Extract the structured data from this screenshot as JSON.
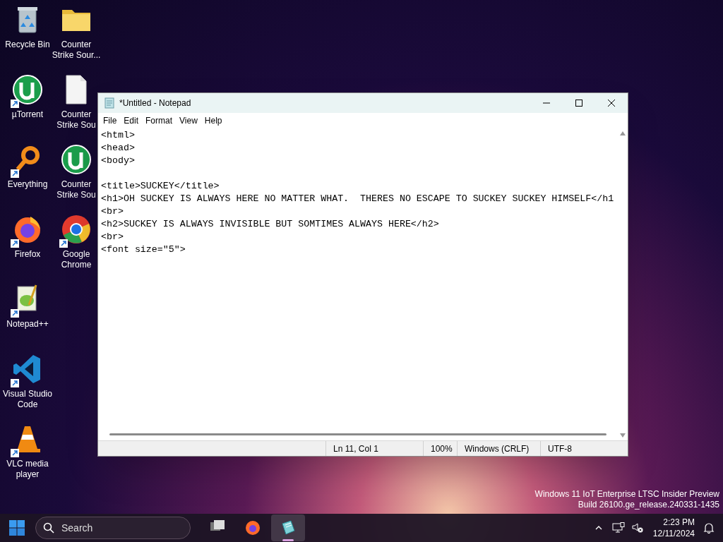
{
  "desktop_icons": [
    {
      "kind": "recycle",
      "label": "Recycle Bin",
      "shortcut": false
    },
    {
      "kind": "utorrent",
      "label": "µTorrent",
      "shortcut": true
    },
    {
      "kind": "everything",
      "label": "Everything",
      "shortcut": true
    },
    {
      "kind": "firefox",
      "label": "Firefox",
      "shortcut": true
    },
    {
      "kind": "notepadpp",
      "label": "Notepad++",
      "shortcut": true
    },
    {
      "kind": "vscode",
      "label": "Visual Studio Code",
      "shortcut": true
    },
    {
      "kind": "vlc",
      "label": "VLC media player",
      "shortcut": true
    },
    {
      "kind": "folder",
      "label": "Counter Strike Sour...",
      "shortcut": false
    },
    {
      "kind": "document",
      "label": "Counter Strike Sou",
      "shortcut": false
    },
    {
      "kind": "utorrent",
      "label": "Counter Strike Sou",
      "shortcut": false
    },
    {
      "kind": "chrome",
      "label": "Google Chrome",
      "shortcut": true
    }
  ],
  "window": {
    "title": "*Untitled - Notepad",
    "menu": [
      "File",
      "Edit",
      "Format",
      "View",
      "Help"
    ],
    "lines": [
      {
        "kind": "text",
        "text": "<html>"
      },
      {
        "kind": "text",
        "text": "<head>"
      },
      {
        "kind": "text",
        "text": "<body>"
      },
      {
        "kind": "blank"
      },
      {
        "kind": "text",
        "text": "<title>SUCKEY</title>"
      },
      {
        "kind": "text",
        "text": "<h1>OH SUCKEY IS ALWAYS HERE NO MATTER WHAT.  THERES NO ESCAPE TO SUCKEY SUCKEY HIMSELF</h1"
      },
      {
        "kind": "text",
        "text": "<br>"
      },
      {
        "kind": "text",
        "text": "<h2>SUCKEY IS ALWAYS INVISIBLE BUT SOMTIMES ALWAYS HERE</h2>"
      },
      {
        "kind": "text",
        "text": "<br>"
      },
      {
        "kind": "text",
        "text": "<font size=\"5\">"
      }
    ],
    "status_bar": [
      "Ln 11, Col 1",
      "100%",
      "Windows (CRLF)",
      "UTF-8"
    ]
  },
  "watermark": [
    "Windows 11 IoT Enterprise LTSC Insider Preview",
    "Build 26100.ge_release.240331-1435"
  ],
  "taskbar": {
    "search": {
      "placeholder": "Search"
    },
    "apps": [
      {
        "kind": "taskview",
        "selected": false
      },
      {
        "kind": "firefox",
        "selected": false
      },
      {
        "kind": "notepad",
        "selected": true
      }
    ],
    "time": "2:23 PM",
    "date": "12/11/2024"
  }
}
